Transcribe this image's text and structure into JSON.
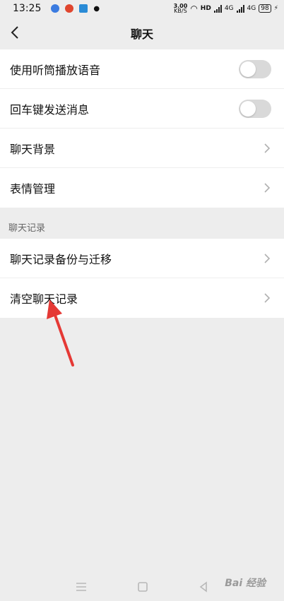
{
  "status": {
    "time": "13:25",
    "speed_value": "3.00",
    "speed_unit": "KB/S",
    "hd": "HD",
    "net1": "4G",
    "net2": "4G",
    "battery": "98"
  },
  "header": {
    "title": "聊天"
  },
  "settings": {
    "use_earpiece": "使用听筒播放语音",
    "enter_to_send": "回车键发送消息",
    "chat_background": "聊天背景",
    "sticker_management": "表情管理"
  },
  "history": {
    "section_title": "聊天记录",
    "backup_migrate": "聊天记录备份与迁移",
    "clear_history": "清空聊天记录"
  },
  "toggles": {
    "use_earpiece": false,
    "enter_to_send": false
  },
  "watermark": "Bai 经验",
  "colors": {
    "arrow": "#e53935",
    "page_bg": "#ededed",
    "toggle_off": "#d9d9d9"
  }
}
